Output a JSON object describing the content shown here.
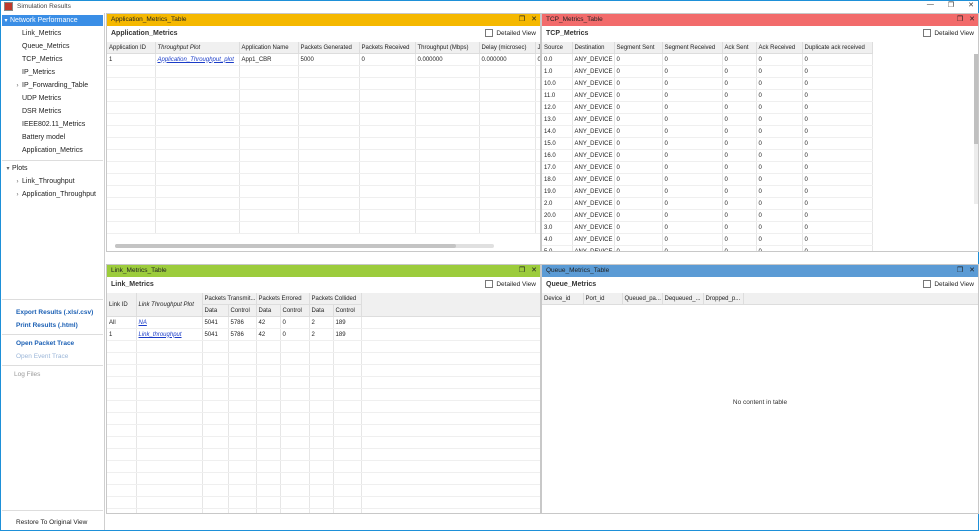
{
  "window": {
    "title": "Simulation Results",
    "controls": [
      "—",
      "❐",
      "✕"
    ]
  },
  "sidebar": {
    "network_performance": "Network Performance",
    "items": [
      "Link_Metrics",
      "Queue_Metrics",
      "TCP_Metrics",
      "IP_Metrics",
      "IP_Forwarding_Table",
      "UDP Metrics",
      "DSR Metrics",
      "IEEE802.11_Metrics",
      "Battery model",
      "Application_Metrics"
    ],
    "plots": "Plots",
    "plot_items": [
      "Link_Throughput",
      "Application_Throughput"
    ],
    "export": "Export Results (.xls/.csv)",
    "print": "Print Results (.html)",
    "open_packet": "Open Packet Trace",
    "open_event": "Open Event Trace",
    "log_files": "Log Files",
    "restore": "Restore To Original View"
  },
  "panels": {
    "app": {
      "title": "Application_Metrics_Table",
      "subtitle": "Application_Metrics",
      "detailed": "Detailed View",
      "color": "#f5b800",
      "headers": [
        "Application ID",
        "Throughput Plot",
        "Application Name",
        "Packets Generated",
        "Packets Received",
        "Throughput (Mbps)",
        "Delay (microsec)",
        "J"
      ],
      "row": [
        "1",
        "Application_Throughput_plot",
        "App1_CBR",
        "5000",
        "0",
        "0.000000",
        "0.000000",
        "0"
      ]
    },
    "tcp": {
      "title": "TCP_Metrics_Table",
      "subtitle": "TCP_Metrics",
      "detailed": "Detailed View",
      "color": "#f26b6b",
      "headers": [
        "Source",
        "Destination",
        "Segment Sent",
        "Segment Received",
        "Ack Sent",
        "Ack Received",
        "Duplicate ack received"
      ],
      "sources": [
        "0.0",
        "1.0",
        "10.0",
        "11.0",
        "12.0",
        "13.0",
        "14.0",
        "15.0",
        "16.0",
        "17.0",
        "18.0",
        "19.0",
        "2.0",
        "20.0",
        "3.0",
        "4.0",
        "5.0"
      ],
      "destination": "ANY_DEVICE",
      "zero": "0"
    },
    "link": {
      "title": "Link_Metrics_Table",
      "subtitle": "Link_Metrics",
      "detailed": "Detailed View",
      "color": "#9ccc3c",
      "headers": [
        "Link ID",
        "Link Throughput Plot",
        "Packets Transmit...",
        "Packets Errored",
        "Packets Collided"
      ],
      "subheaders": [
        "Data",
        "Control",
        "Data",
        "Control",
        "Data",
        "Control"
      ],
      "rows": [
        [
          "All",
          "NA",
          "5041",
          "5786",
          "42",
          "0",
          "2",
          "189"
        ],
        [
          "1",
          "Link_throughput",
          "5041",
          "5786",
          "42",
          "0",
          "2",
          "189"
        ]
      ]
    },
    "queue": {
      "title": "Queue_Metrics_Table",
      "subtitle": "Queue_Metrics",
      "detailed": "Detailed View",
      "color": "#5b9bd5",
      "headers": [
        "Device_id",
        "Port_id",
        "Queued_pa...",
        "Dequeued_...",
        "Dropped_p..."
      ],
      "empty": "No content in table"
    }
  }
}
